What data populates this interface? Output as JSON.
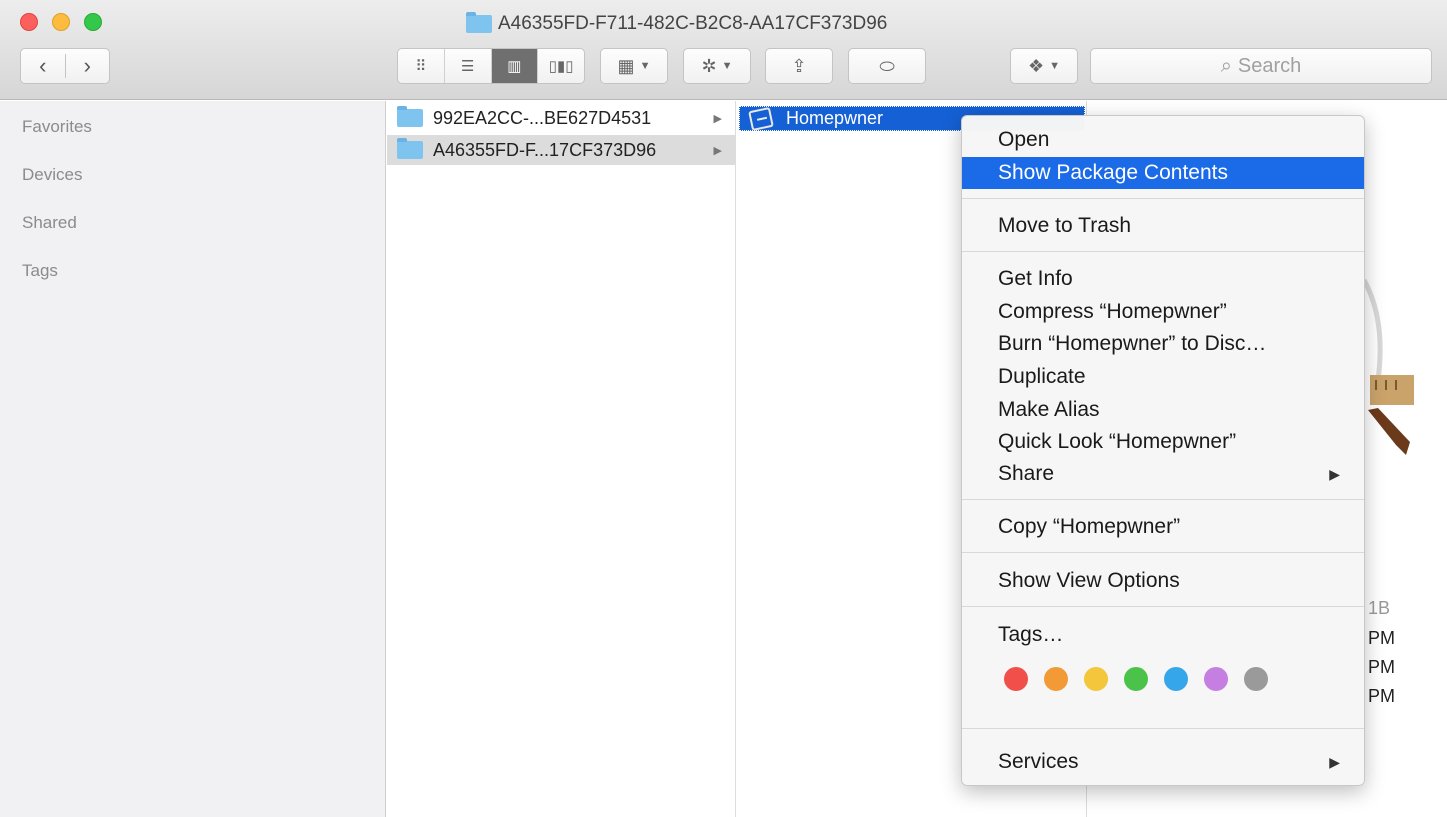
{
  "window": {
    "title": "A46355FD-F711-482C-B2C8-AA17CF373D96"
  },
  "toolbar": {
    "back_icon": "chevron-left-icon",
    "forward_icon": "chevron-right-icon",
    "view_icons": "icon-view-icon",
    "view_list": "list-view-icon",
    "view_columns": "column-view-icon",
    "view_coverflow": "coverflow-view-icon",
    "arrange_icon": "arrange-icon",
    "action_icon": "gear-icon",
    "share_icon": "share-icon",
    "tag_icon": "tag-icon",
    "dropbox_icon": "dropbox-icon",
    "search_placeholder": "Search"
  },
  "sidebar": {
    "items": [
      {
        "label": "Favorites"
      },
      {
        "label": "Devices"
      },
      {
        "label": "Shared"
      },
      {
        "label": "Tags"
      }
    ]
  },
  "columns": {
    "col1": [
      {
        "label": "992EA2CC-...BE627D4531"
      },
      {
        "label": "A46355FD-F...17CF373D96"
      }
    ],
    "col2": [
      {
        "label": "Homepwner"
      }
    ]
  },
  "preview": {
    "size_fragment": "1B",
    "time_fragments": [
      "PM",
      "PM",
      "PM"
    ]
  },
  "context_menu": {
    "items": [
      "Open",
      "Show Package Contents",
      "Move to Trash",
      "Get Info",
      "Compress “Homepwner”",
      "Burn “Homepwner” to Disc…",
      "Duplicate",
      "Make Alias",
      "Quick Look “Homepwner”",
      "Share",
      "Copy “Homepwner”",
      "Show View Options",
      "Tags…",
      "Services"
    ],
    "tag_colors": [
      "#f04f4a",
      "#f19a36",
      "#f3c63c",
      "#4bc24a",
      "#36a6ea",
      "#c47fe0",
      "#9a9a9a"
    ]
  }
}
